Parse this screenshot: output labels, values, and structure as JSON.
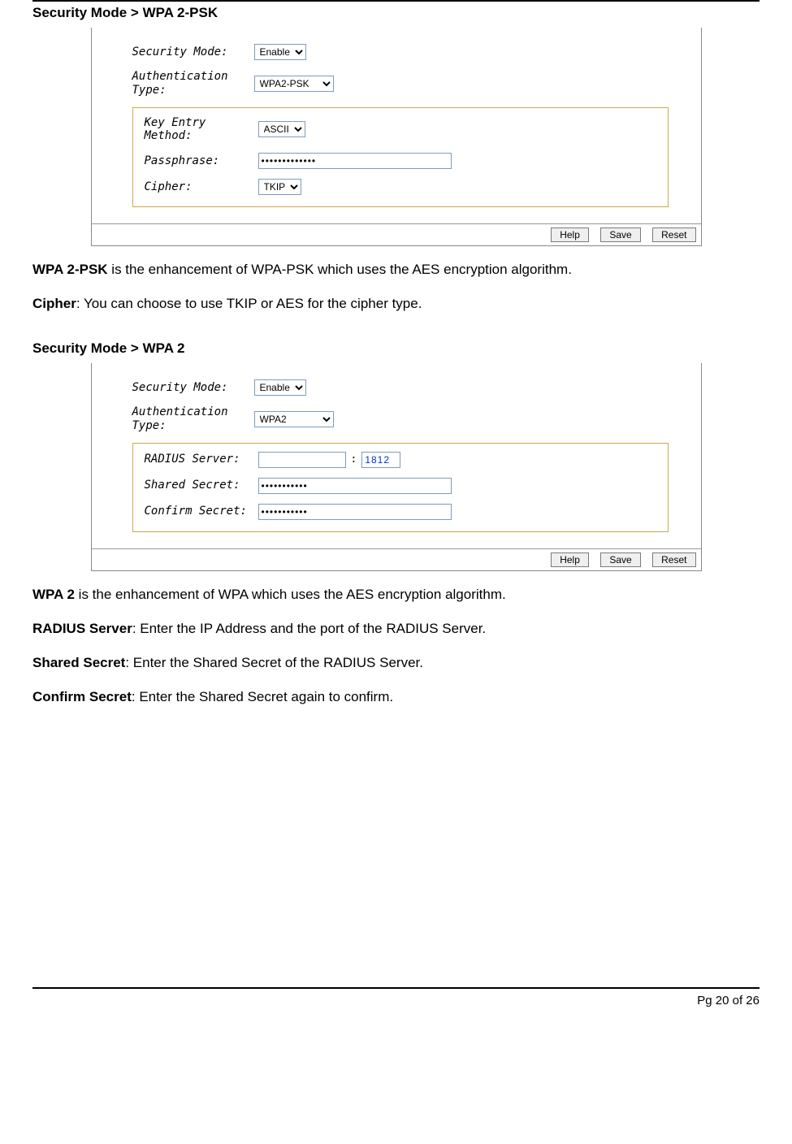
{
  "heading1": "Security Mode > WPA 2-PSK",
  "panel1": {
    "security_mode_label": "Security Mode:",
    "security_mode_value": "Enable",
    "auth_type_label": "Authentication Type:",
    "auth_type_value": "WPA2-PSK",
    "key_entry_label": "Key Entry Method:",
    "key_entry_value": "ASCII",
    "passphrase_label": "Passphrase:",
    "passphrase_value": "•••••••••••••",
    "cipher_label": "Cipher:",
    "cipher_value": "TKIP",
    "btn_help": "Help",
    "btn_save": "Save",
    "btn_reset": "Reset"
  },
  "para1_b": "WPA 2-PSK",
  "para1_rest": " is the enhancement of WPA-PSK which uses the AES encryption algorithm.",
  "para2_b": "Cipher",
  "para2_rest": ": You can choose to use TKIP or AES for the cipher type.",
  "heading2": "Security Mode > WPA 2",
  "panel2": {
    "security_mode_label": "Security Mode:",
    "security_mode_value": "Enable",
    "auth_type_label": "Authentication Type:",
    "auth_type_value": "WPA2",
    "radius_label": "RADIUS Server:",
    "radius_ip_value": "",
    "radius_sep": ":",
    "radius_port_value": "1812",
    "shared_secret_label": "Shared Secret:",
    "shared_secret_value": "•••••••••••",
    "confirm_secret_label": "Confirm Secret:",
    "confirm_secret_value": "•••••••••••",
    "btn_help": "Help",
    "btn_save": "Save",
    "btn_reset": "Reset"
  },
  "para3_b": "WPA 2",
  "para3_rest": " is the enhancement of WPA which uses the AES encryption algorithm.",
  "para4_b": "RADIUS Server",
  "para4_rest": ": Enter the IP Address and the port of the RADIUS Server.",
  "para5_b": "Shared Secret",
  "para5_rest": ": Enter the Shared Secret of the RADIUS Server.",
  "para6_b": "Confirm Secret",
  "para6_rest": ": Enter the Shared Secret again to confirm.",
  "footer": "Pg 20 of 26"
}
